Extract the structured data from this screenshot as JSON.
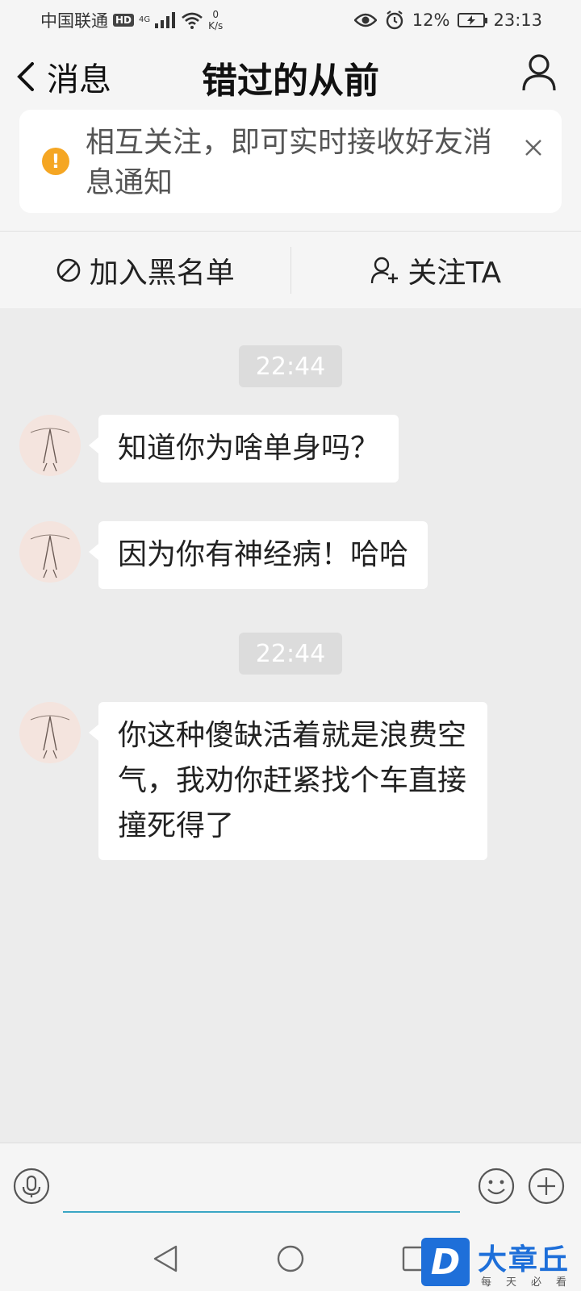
{
  "status_bar": {
    "carrier": "中国联通",
    "hd": "HD",
    "network": "4G",
    "speed_value": "0",
    "speed_unit": "K/s",
    "battery": "12%",
    "time": "23:13"
  },
  "header": {
    "back_label": "消息",
    "title": "错过的从前"
  },
  "notice": {
    "icon": "!",
    "text": "相互关注，即可实时接收好友消息通知"
  },
  "actions": {
    "blacklist_label": "加入黑名单",
    "follow_label": "关注TA"
  },
  "chat": {
    "timestamps": [
      "22:44",
      "22:44"
    ],
    "messages": [
      {
        "text": "知道你为啥单身吗？"
      },
      {
        "text": "因为你有神经病！哈哈"
      },
      {
        "text": "你这种傻缺活着就是浪费空气，我劝你赶紧找个车直接撞死得了"
      }
    ]
  },
  "input": {
    "placeholder": ""
  },
  "watermark": {
    "logo_letter": "D",
    "name": "大章丘",
    "tagline": "每天必看"
  },
  "colors": {
    "accent_line": "#3aa6c4",
    "warning": "#f5a623",
    "chat_bg": "#ececec",
    "bubble": "#ffffff",
    "watermark_blue": "#1e6fd9"
  },
  "icons": {
    "back": "chevron-left-icon",
    "profile": "user-icon",
    "warning": "warning-icon",
    "close": "close-icon",
    "blacklist": "block-icon",
    "follow": "add-user-icon",
    "mic": "mic-icon",
    "emoji": "emoji-icon",
    "plus": "plus-icon"
  }
}
